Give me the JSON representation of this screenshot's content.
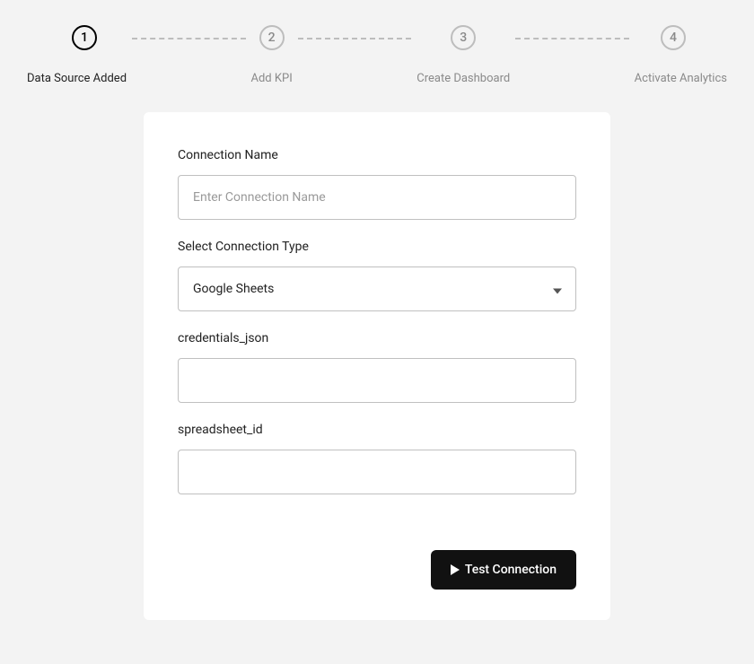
{
  "stepper": {
    "steps": [
      {
        "num": "1",
        "label": "Data Source Added",
        "active": true
      },
      {
        "num": "2",
        "label": "Add KPI",
        "active": false
      },
      {
        "num": "3",
        "label": "Create Dashboard",
        "active": false
      },
      {
        "num": "4",
        "label": "Activate Analytics",
        "active": false
      }
    ]
  },
  "form": {
    "connection_name_label": "Connection Name",
    "connection_name_placeholder": "Enter Connection Name",
    "connection_name_value": "",
    "connection_type_label": "Select Connection Type",
    "connection_type_value": "Google Sheets",
    "credentials_json_label": "credentials_json",
    "credentials_json_value": "",
    "spreadsheet_id_label": "spreadsheet_id",
    "spreadsheet_id_value": ""
  },
  "actions": {
    "test_connection_label": "Test Connection"
  }
}
